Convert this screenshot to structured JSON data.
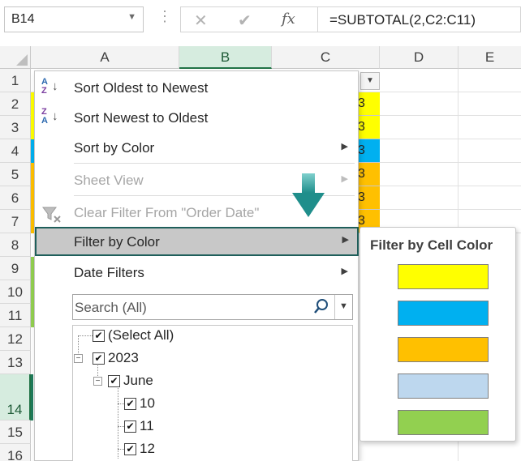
{
  "formula_bar": {
    "name_box": "B14",
    "cancel_glyph": "✕",
    "enter_glyph": "✔",
    "fx_label": "fx",
    "formula": "=SUBTOTAL(2,C2:C11)"
  },
  "columns": [
    "A",
    "B",
    "C",
    "D",
    "E"
  ],
  "rows": [
    "1",
    "2",
    "3",
    "4",
    "5",
    "6",
    "7",
    "8",
    "9",
    "10",
    "11",
    "12",
    "13",
    "14",
    "15",
    "16"
  ],
  "selected": {
    "column": "B",
    "row": "14"
  },
  "filter_menu": {
    "items": [
      {
        "label": "Sort Oldest to Newest",
        "icon": "sort-ascending-icon"
      },
      {
        "label": "Sort Newest to Oldest",
        "icon": "sort-descending-icon"
      },
      {
        "label": "Sort by Color",
        "submenu": true
      },
      {
        "label": "Sheet View",
        "submenu": true,
        "disabled": true
      },
      {
        "label": "Clear Filter From \"Order Date\"",
        "icon": "clear-filter-icon",
        "disabled": true
      },
      {
        "label": "Filter by Color",
        "submenu": true,
        "highlighted": true
      },
      {
        "label": "Date Filters",
        "submenu": true
      }
    ],
    "search_placeholder": "Search (All)",
    "tree": [
      {
        "label": "(Select All)",
        "checked": true
      },
      {
        "label": "2023",
        "checked": true,
        "expanded": true
      },
      {
        "label": "June",
        "checked": true,
        "expanded": true
      },
      {
        "label": "10",
        "checked": true
      },
      {
        "label": "11",
        "checked": true
      },
      {
        "label": "12",
        "checked": true
      }
    ]
  },
  "filter_by_color_submenu": {
    "title": "Filter by Cell Color",
    "swatches": [
      "#ffff00",
      "#00b0f0",
      "#ffc000",
      "#bdd7ee",
      "#92d050"
    ]
  },
  "visible_cell_colors": {
    "row_2": "#ffff00",
    "row_3": "#ffff00",
    "row_4": "#00b0f0",
    "row_5": "#ffc000",
    "row_6": "#ffc000",
    "row_7": "#ffc000",
    "row_9": "#92d050",
    "row_10": "#92d050",
    "row_11": "#92d050"
  },
  "column_c_partial_text": "3"
}
